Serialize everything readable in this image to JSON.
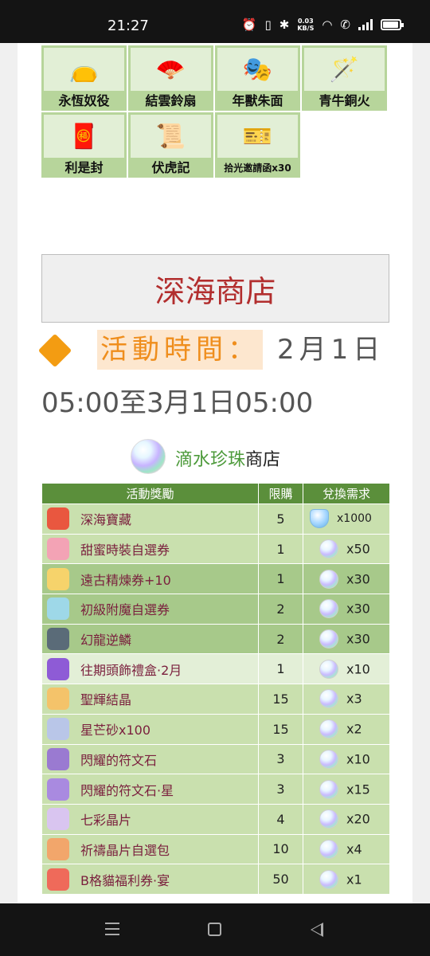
{
  "status_bar": {
    "time": "21:27",
    "net_speed_value": "0.03",
    "net_speed_unit": "KB/S",
    "icons": [
      "alarm-icon",
      "vibrate-icon",
      "bluetooth-icon",
      "wifi-icon",
      "wifi-calling-icon",
      "signal-icon",
      "battery-icon"
    ]
  },
  "items": [
    {
      "name": "永恆奴役",
      "icon": "pouch-icon"
    },
    {
      "name": "結雲鈴扇",
      "icon": "fan-icon"
    },
    {
      "name": "年獸朱面",
      "icon": "mask-icon"
    },
    {
      "name": "青牛銅火",
      "icon": "staff-icon"
    },
    {
      "name": "利是封",
      "icon": "red-envelope-icon"
    },
    {
      "name": "伏虎記",
      "icon": "book-icon"
    },
    {
      "name": "拾光邀請函x30",
      "icon": "ticket-icon"
    }
  ],
  "shop_title": "深海商店",
  "activity": {
    "label": "活動時間：",
    "date_line1": "2月1日",
    "date_line2": "05:00至3月1日05:00"
  },
  "pearl_shop": {
    "title_green": "滴水珍珠",
    "title_black": "商店"
  },
  "table": {
    "headers": [
      "活動獎勵",
      "限購",
      "兌換需求"
    ],
    "rows": [
      {
        "item": "深海寶藏",
        "limit": "5",
        "cost": "x1000",
        "icon": "treasure-chest-icon",
        "coin": "shield-gem-icon",
        "tone": "light",
        "color": "#e9573f"
      },
      {
        "item": "甜蜜時裝自選券",
        "limit": "1",
        "cost": "x50",
        "icon": "fashion-ticket-icon",
        "coin": "pearl-icon",
        "tone": "light",
        "color": "#f3a3b5"
      },
      {
        "item": "遠古精煉券+10",
        "limit": "1",
        "cost": "x30",
        "icon": "refine-ticket-icon",
        "coin": "pearl-icon",
        "tone": "dark",
        "color": "#f6d36b"
      },
      {
        "item": "初級附魔自選券",
        "limit": "2",
        "cost": "x30",
        "icon": "enchant-ticket-icon",
        "coin": "pearl-icon",
        "tone": "dark",
        "color": "#9ed8e8"
      },
      {
        "item": "幻龍逆鱗",
        "limit": "2",
        "cost": "x30",
        "icon": "dragon-scale-icon",
        "coin": "pearl-icon",
        "tone": "dark",
        "color": "#5a6b78"
      },
      {
        "item": "往期頭飾禮盒·2月",
        "limit": "1",
        "cost": "x10",
        "icon": "gift-box-icon",
        "coin": "pearl-icon",
        "tone": "pale",
        "color": "#8e5bd6"
      },
      {
        "item": "聖輝結晶",
        "limit": "15",
        "cost": "x3",
        "icon": "crystal-icon",
        "coin": "pearl-icon",
        "tone": "light",
        "color": "#f4c36a"
      },
      {
        "item": "星芒砂x100",
        "limit": "15",
        "cost": "x2",
        "icon": "star-sand-icon",
        "coin": "pearl-icon",
        "tone": "light",
        "color": "#b9c6e8"
      },
      {
        "item": "閃耀的符文石",
        "limit": "3",
        "cost": "x10",
        "icon": "rune-stone-icon",
        "coin": "pearl-icon",
        "tone": "light",
        "color": "#9a7ad1"
      },
      {
        "item": "閃耀的符文石·星",
        "limit": "3",
        "cost": "x15",
        "icon": "rune-star-icon",
        "coin": "pearl-icon",
        "tone": "light",
        "color": "#a98ae0"
      },
      {
        "item": "七彩晶片",
        "limit": "4",
        "cost": "x20",
        "icon": "rainbow-chip-icon",
        "coin": "pearl-icon",
        "tone": "light",
        "color": "#d9c5f0"
      },
      {
        "item": "祈禱晶片自選包",
        "limit": "10",
        "cost": "x4",
        "icon": "chip-pack-icon",
        "coin": "pearl-icon",
        "tone": "light",
        "color": "#f2a66b"
      },
      {
        "item": "B格貓福利券·宴",
        "limit": "50",
        "cost": "x1",
        "icon": "cat-coupon-icon",
        "coin": "pearl-icon",
        "tone": "light",
        "color": "#ef6a5a"
      }
    ]
  },
  "nav_bar": {
    "buttons": [
      "menu-button",
      "home-button",
      "back-button"
    ]
  }
}
